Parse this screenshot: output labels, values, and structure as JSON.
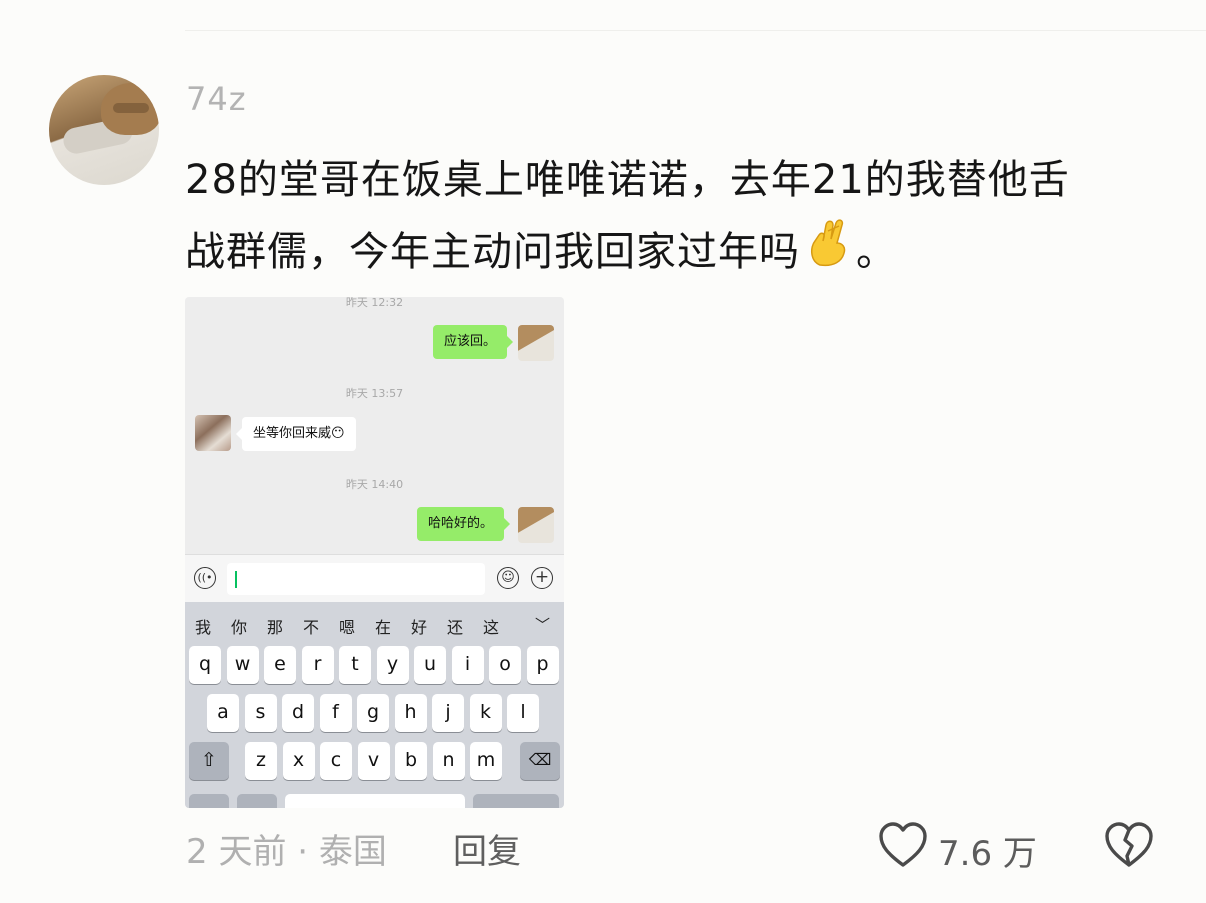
{
  "comment": {
    "username": "74z",
    "text_line1": "28的堂哥在饭桌上唯唯诺诺，去年21的我替他舌",
    "text_line2": "战群儒，今年主动问我回家过年吗",
    "text_end": "。",
    "emoji_icon": "crossed-fingers-icon"
  },
  "screenshot": {
    "messages": [
      {
        "time": "昨天 12:32",
        "side": "right",
        "text": "应该回。"
      },
      {
        "time": "昨天 13:57",
        "side": "left",
        "text": "坐等你回来威😶"
      },
      {
        "time": "昨天 14:40",
        "side": "right",
        "text": "哈哈好的。"
      }
    ],
    "candidates": [
      "我",
      "你",
      "那",
      "不",
      "嗯",
      "在",
      "好",
      "还",
      "这"
    ],
    "keyboard_rows": [
      [
        "q",
        "w",
        "e",
        "r",
        "t",
        "y",
        "u",
        "i",
        "o",
        "p"
      ],
      [
        "a",
        "s",
        "d",
        "f",
        "g",
        "h",
        "j",
        "k",
        "l"
      ],
      [
        "z",
        "x",
        "c",
        "v",
        "b",
        "n",
        "m"
      ]
    ]
  },
  "footer": {
    "meta": "2 天前 · 泰国",
    "reply_label": "回复",
    "like_count": "7.6 万"
  },
  "colors": {
    "bubble_green": "#95ec69",
    "text_dark": "#161616",
    "text_muted": "#b0b0b0"
  }
}
